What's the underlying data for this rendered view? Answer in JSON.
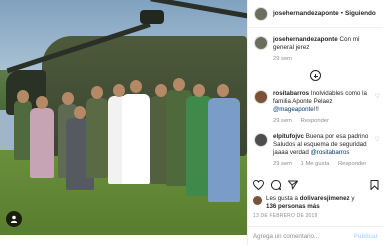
{
  "post": {
    "author": "josehernandezaponte",
    "follow_separator": "•",
    "following_label": "Siguiendo"
  },
  "caption": {
    "username": "josehernandezaponte",
    "text": "Con mi general jerez",
    "time": "29 sem"
  },
  "comments": [
    {
      "username": "rositabarros",
      "text": "Inolvidables como la familia Aponte Pelaez",
      "mention": "@mageaponte",
      "emoji": "!!!",
      "time": "29 sem",
      "reply_label": "Responder"
    },
    {
      "username": "elpitufojvc",
      "text": "Buena por esa padrino Saludos al esquema de seguridad jaaaa verdad",
      "mention": "@rositabarros",
      "time": "29 sem",
      "likes_label": "1 Me gusta",
      "reply_label": "Responder"
    }
  ],
  "actions": {
    "like_icon": "heart-icon",
    "comment_icon": "comment-icon",
    "share_icon": "share-icon",
    "save_icon": "bookmark-icon"
  },
  "likes": {
    "prefix": "Les gusta a",
    "first_user": "dolivaresjimenez",
    "conjunction": "y",
    "others": "136 personas",
    "suffix": "más"
  },
  "date": "13 DE FEBRERO DE 2019",
  "add_comment": {
    "placeholder": "Agrega un comentario...",
    "post_label": "Publicar"
  },
  "colors": {
    "link": "#00376b",
    "muted": "#8e8e8e",
    "post_disabled": "#b3dbff"
  }
}
